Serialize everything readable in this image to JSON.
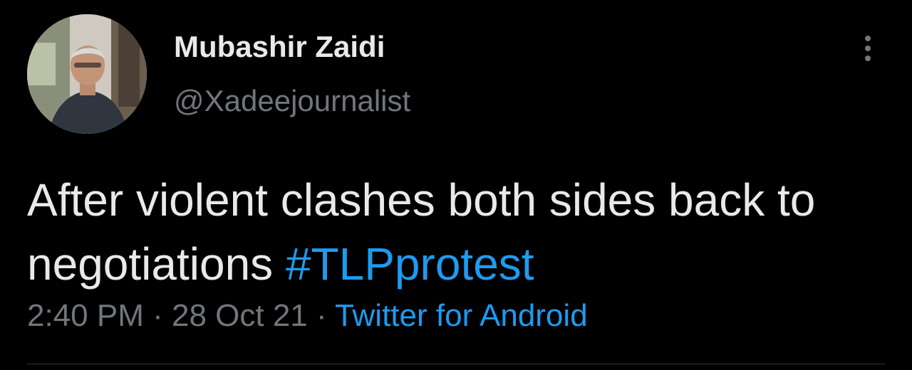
{
  "author": {
    "display_name": "Mubashir Zaidi",
    "handle": "@Xadeejournalist"
  },
  "tweet": {
    "text_before_hashtag": "After violent clashes both sides back to negotiations ",
    "hashtag": "#TLPprotest"
  },
  "meta": {
    "time": "2:40 PM",
    "separator_1": " · ",
    "date": "28 Oct 21",
    "separator_2": " · ",
    "source": "Twitter for Android"
  },
  "icons": {
    "more": "more-vertical-icon",
    "avatar": "avatar"
  },
  "colors": {
    "background": "#000000",
    "text": "#e7e9ea",
    "muted": "#71767b",
    "accent": "#1d9bf0",
    "divider": "#2f3336"
  }
}
